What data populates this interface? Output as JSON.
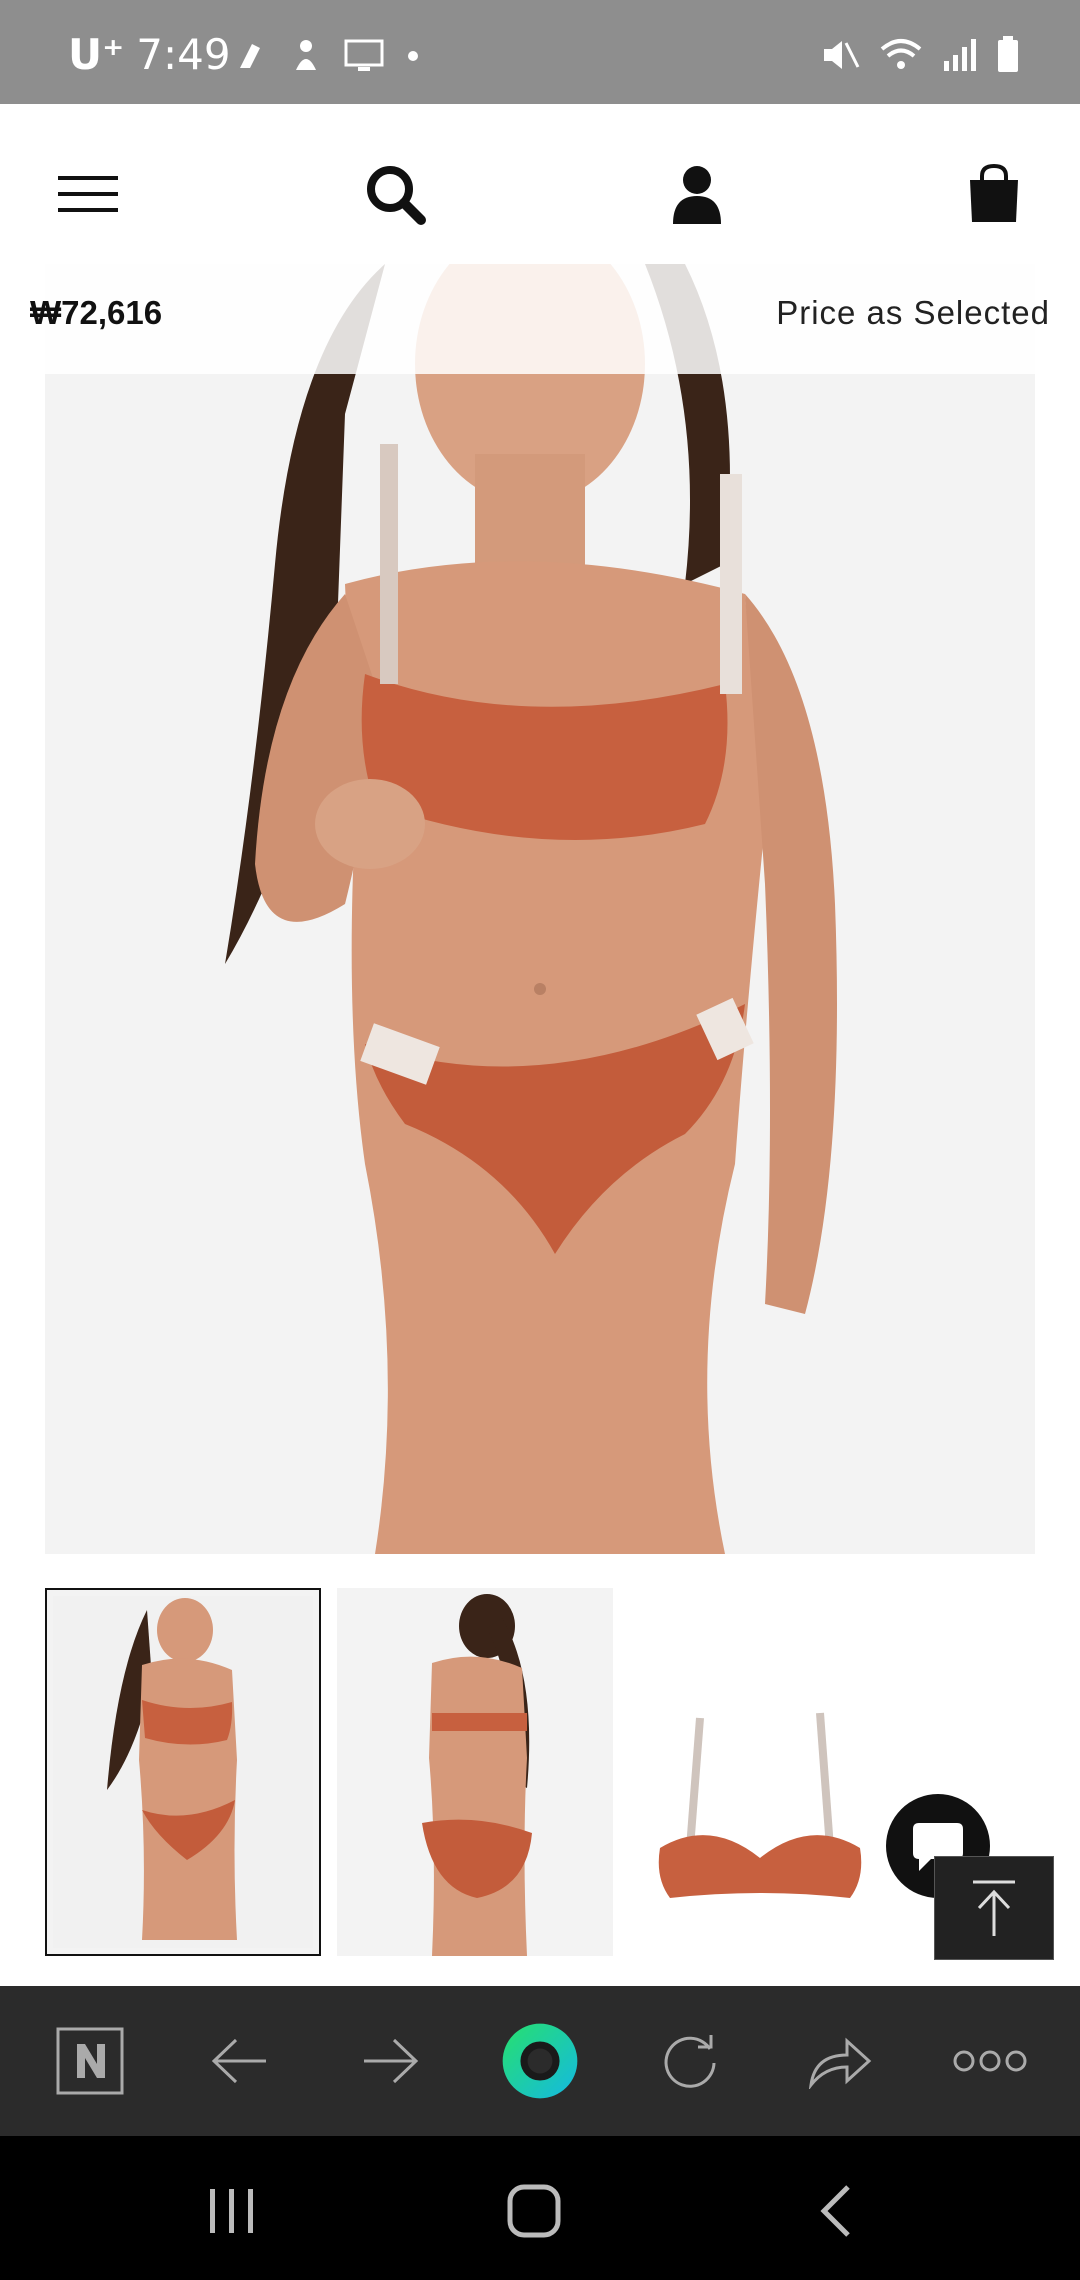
{
  "status_bar": {
    "carrier": "U⁺",
    "time": "7:49"
  },
  "header": {
    "icons": [
      "menu-icon",
      "search-icon",
      "account-icon",
      "shopping-bag-icon"
    ]
  },
  "product": {
    "price": "₩72,616",
    "price_note": "Price as Selected"
  },
  "colors": {
    "status_bar_bg": "#8e8e8e",
    "product_color": "#c7603f",
    "toolbar_bg": "#2b2b2b",
    "accent_ring": "#19d39a"
  },
  "browser_toolbar": {
    "icons": [
      "naver-home-icon",
      "back-arrow-icon",
      "forward-arrow-icon",
      "green-dot-icon",
      "refresh-icon",
      "share-icon",
      "more-icon"
    ]
  }
}
